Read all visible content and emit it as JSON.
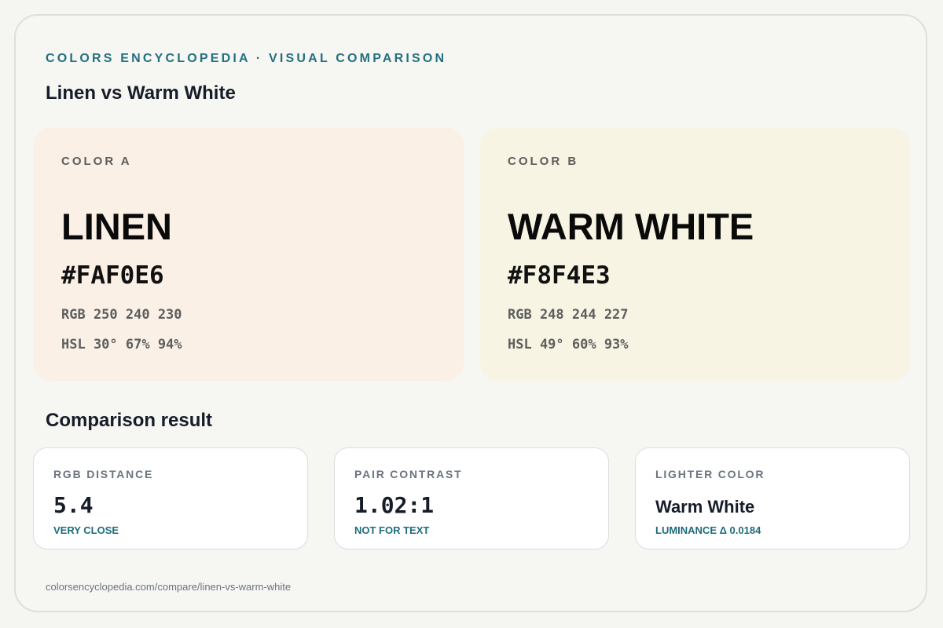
{
  "header": {
    "eyebrow": "COLORS ENCYCLOPEDIA · VISUAL COMPARISON",
    "title": "Linen vs Warm White"
  },
  "colors": [
    {
      "label": "COLOR A",
      "name": "LINEN",
      "hex": "#FAF0E6",
      "rgb": "RGB 250 240 230",
      "hsl": "HSL 30° 67% 94%",
      "swatch_color": "#FAF0E6"
    },
    {
      "label": "COLOR B",
      "name": "WARM WHITE",
      "hex": "#F8F4E3",
      "rgb": "RGB 248 244 227",
      "hsl": "HSL 49° 60% 93%",
      "swatch_color": "#F8F4E3"
    }
  ],
  "comparison": {
    "title": "Comparison result",
    "metrics": [
      {
        "label": "RGB DISTANCE",
        "value": "5.4",
        "note": "VERY CLOSE"
      },
      {
        "label": "PAIR CONTRAST",
        "value": "1.02:1",
        "note": "NOT FOR TEXT"
      },
      {
        "label": "LIGHTER COLOR",
        "value": "Warm White",
        "note": "LUMINANCE Δ 0.0184"
      }
    ]
  },
  "footer": {
    "url": "colorsencyclopedia.com/compare/linen-vs-warm-white"
  },
  "theme": {
    "accent": "#237080",
    "note_color": "#1e6b7b",
    "background": "#F6F6F2"
  }
}
